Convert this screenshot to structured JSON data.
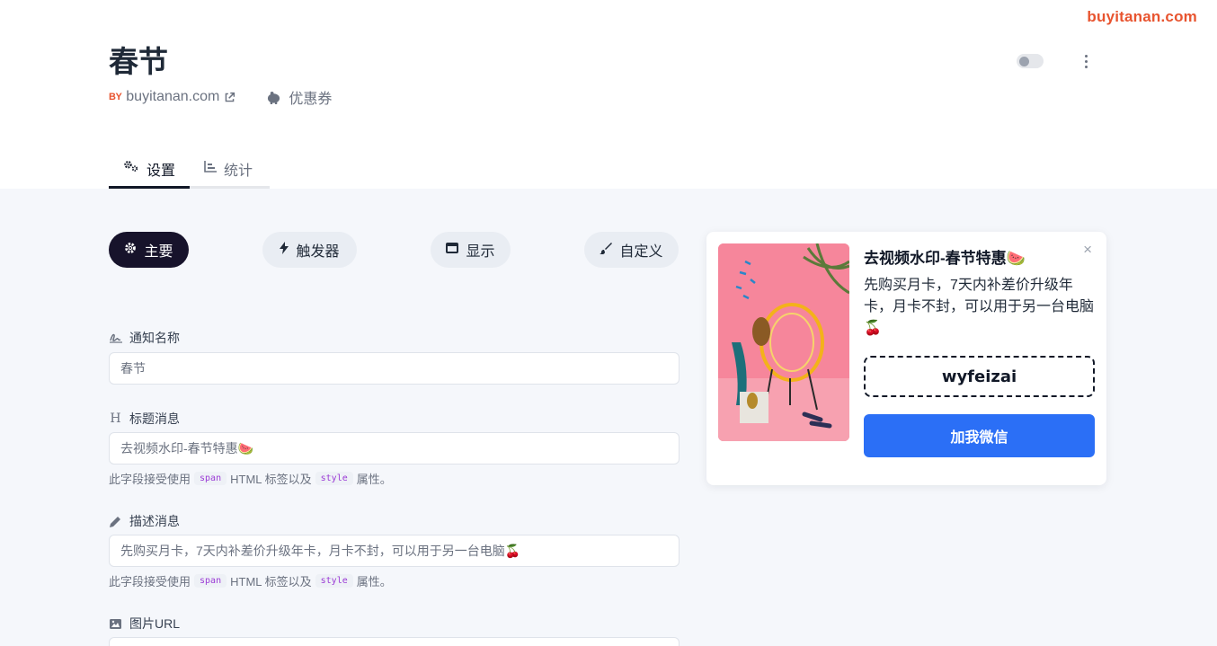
{
  "watermark": "buyitanan.com",
  "header": {
    "title": "春节",
    "by_badge": "BY",
    "site": "buyitanan.com",
    "coupon_label": "优惠券"
  },
  "tabs": [
    {
      "label": "设置",
      "icon": "gears-icon",
      "active": true
    },
    {
      "label": "统计",
      "icon": "chart-icon",
      "active": false
    }
  ],
  "pills": [
    {
      "label": "主要",
      "icon": "gear-icon",
      "active": true
    },
    {
      "label": "触发器",
      "icon": "bolt-icon",
      "active": false
    },
    {
      "label": "显示",
      "icon": "window-icon",
      "active": false
    },
    {
      "label": "自定义",
      "icon": "brush-icon",
      "active": false
    }
  ],
  "fields": {
    "name": {
      "label": "通知名称",
      "value": "春节"
    },
    "title": {
      "label": "标题消息",
      "value": "去视频水印-春节特惠🍉",
      "hint_pre": "此字段接受使用",
      "hint_code1": "span",
      "hint_mid": "HTML 标签以及",
      "hint_code2": "style",
      "hint_post": "属性。"
    },
    "desc": {
      "label": "描述消息",
      "value": "先购买月卡，7天内补差价升级年卡，月卡不封，可以用于另一台电脑🍒",
      "hint_pre": "此字段接受使用",
      "hint_code1": "span",
      "hint_mid": "HTML 标签以及",
      "hint_code2": "style",
      "hint_post": "属性。"
    },
    "image": {
      "label": "图片URL"
    }
  },
  "preview": {
    "title": "去视频水印-春节特惠🍉",
    "desc": "先购买月卡，7天内补差价升级年卡，月卡不封，可以用于另一台电脑🍒",
    "coupon_code": "wyfeizai",
    "cta": "加我微信",
    "close": "×"
  },
  "colors": {
    "accent": "#2b6ff6",
    "brand": "#e8542f",
    "dark_pill": "#17132b",
    "image_bg": "#f6869b"
  }
}
